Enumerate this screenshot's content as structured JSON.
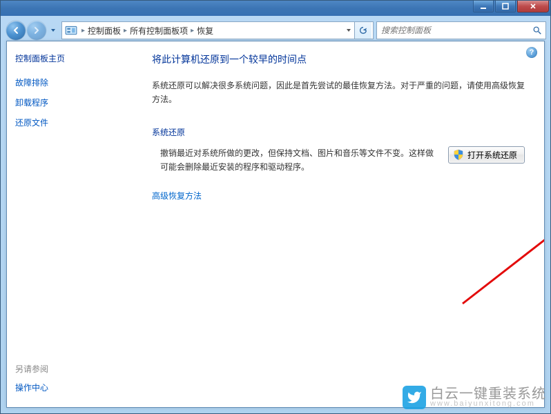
{
  "titlebar": {
    "minimize_label": "Minimize",
    "maximize_label": "Maximize",
    "close_label": "Close"
  },
  "nav": {
    "back_label": "Back",
    "forward_label": "Forward"
  },
  "breadcrumb": {
    "level1": "控制面板",
    "level2": "所有控制面板项",
    "level3": "恢复"
  },
  "search": {
    "placeholder": "搜索控制面板"
  },
  "sidebar": {
    "main": "控制面板主页",
    "links": [
      "故障排除",
      "卸载程序",
      "还原文件"
    ],
    "see_also_header": "另请参阅",
    "see_also_link": "操作中心"
  },
  "content": {
    "help_tooltip": "?",
    "page_title": "将此计算机还原到一个较早的时间点",
    "intro_text": "系统还原可以解决很多系统问题，因此是首先尝试的最佳恢复方法。对于严重的问题，请使用高级恢复方法。",
    "section_title": "系统还原",
    "section_desc": "撤销最近对系统所做的更改，但保持文档、图片和音乐等文件不变。这样做可能会删除最近安装的程序和驱动程序。",
    "action_button_label": "打开系统还原",
    "advanced_link": "高级恢复方法"
  },
  "watermark": {
    "text": "白云一键重装系统",
    "url": "www.baiyunxitong.com"
  }
}
